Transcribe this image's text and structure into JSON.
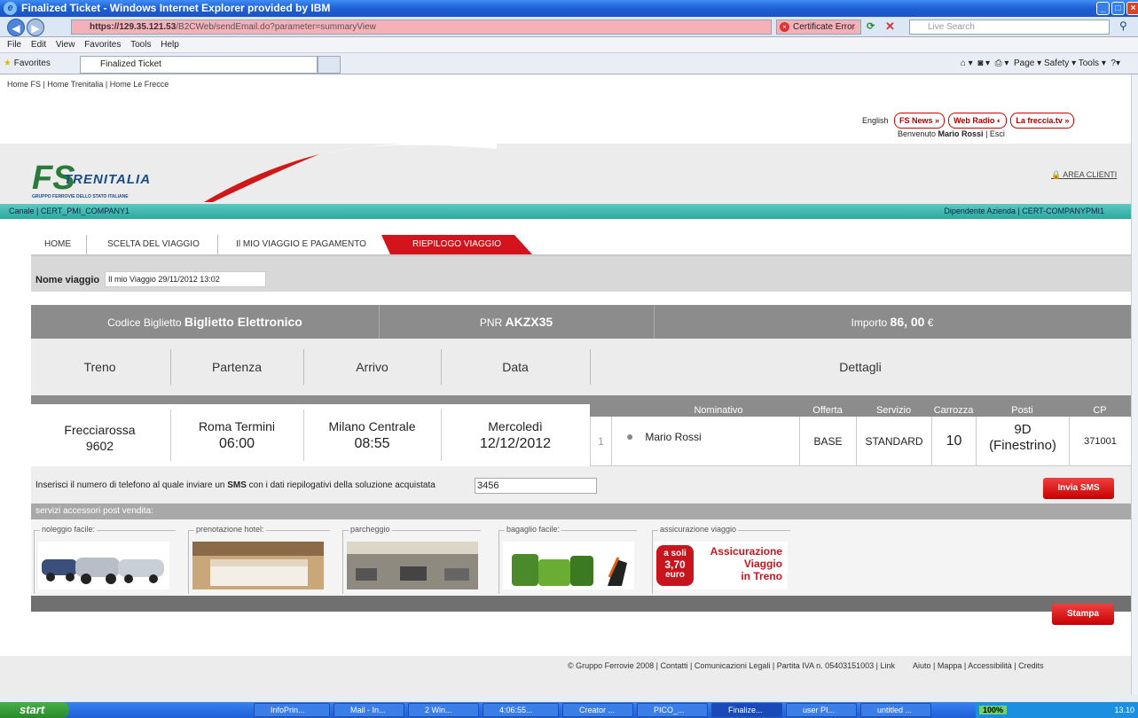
{
  "browser": {
    "title": "Finalized Ticket - Windows Internet Explorer provided by IBM",
    "url_host": "https://129.35.121.53",
    "url_path": "/B2CWeb/sendEmail.do?parameter=summaryView",
    "cert_error": "Certificate Error",
    "search_placeholder": "Live Search",
    "menu": [
      "File",
      "Edit",
      "View",
      "Favorites",
      "Tools",
      "Help"
    ],
    "favorites_label": "Favorites",
    "tab_label": "Finalized Ticket",
    "tools": "Page ▾   Safety ▾   Tools ▾"
  },
  "site": {
    "top_links": "Home FS | Home Trenitalia | Home Le Frecce",
    "language": "English",
    "pills": [
      "FS News  »",
      "Web Radio ◐",
      "La freccia.tv  »"
    ],
    "welcome_prefix": "Benvenuto ",
    "welcome_name": "Mario Rossi",
    "welcome_suffix": " | Esci",
    "logo_mark": "FS",
    "logo_name": "TRENITALIA",
    "logo_sub": "GRUPPO FERROVIE DELLO STATO ITALIANE",
    "area_clienti": "AREA CLIENTI",
    "canale": "Canale | CERT_PMI_COMPANY1",
    "dipendente": "Dipendente Azienda | CERT-COMPANYPMI1"
  },
  "tabs": [
    "HOME",
    "SCELTA DEL VIAGGIO",
    "Il MIO VIAGGIO E PAGAMENTO",
    "RIEPILOGO VIAGGIO"
  ],
  "nome_viaggio": {
    "label": "Nome viaggio",
    "value": "Il mio Viaggio 29/11/2012 13:02"
  },
  "summary": {
    "codice_label": "Codice Biglietto ",
    "codice_value": "Biglietto Elettronico",
    "pnr_label": "PNR ",
    "pnr_value": "AKZX35",
    "importo_label": "Importo ",
    "importo_value": "86, 00",
    "currency": " €"
  },
  "headers": [
    "Treno",
    "Partenza",
    "Arrivo",
    "Data",
    "Dettagli"
  ],
  "journey": {
    "train_name": "Frecciarossa",
    "train_num": "9602",
    "dep_station": "Roma Termini",
    "dep_time": "06:00",
    "arr_station": "Milano Centrale",
    "arr_time": "08:55",
    "day": "Mercoledì",
    "date": "12/12/2012"
  },
  "passenger_headers": [
    "Nominativo",
    "Offerta",
    "Servizio",
    "Carrozza",
    "Posti",
    "CP"
  ],
  "passenger": {
    "index": "1",
    "name": "Mario  Rossi",
    "offerta": "BASE",
    "servizio": "STANDARD",
    "carrozza": "10",
    "posto": "9D",
    "posto_tipo": "(Finestrino)",
    "cp": "371001"
  },
  "sms": {
    "text_prefix": "Inserisci il numero di telefono al quale inviare un ",
    "text_bold": "SMS",
    "text_suffix": " con i dati riepilogativi della soluzione acquistata",
    "value": "3456",
    "button": "Invia SMS"
  },
  "servizi_title": "servizi accessori post vendita:",
  "servizi": [
    "noleggio facile:",
    "prenotazione hotel:",
    "parcheggio",
    "bagaglio facile:",
    "assicurazione viaggio"
  ],
  "promo": {
    "l1": "a soli",
    "l2": "3,70",
    "l3": "euro",
    "t1": "Assicurazione",
    "t2": "Viaggio",
    "t3": "in Treno"
  },
  "stampa": "Stampa",
  "footer_left": "© Gruppo Ferrovie 2008 | Contatti | Comunicazioni Legali | Partita IVA n. 05403151003 | Link",
  "footer_right": "Aiuto | Mappa | Accessibilità | Credits",
  "taskbar": {
    "start": "start",
    "tasks": [
      "InfoPrin...",
      "Mail - In...",
      "2 Win...",
      "4:06:55...",
      "Creator ...",
      "PICO_...",
      "Finalize...",
      "user PI...",
      "untitled ..."
    ],
    "battery": "100%",
    "clock": "13.10"
  }
}
